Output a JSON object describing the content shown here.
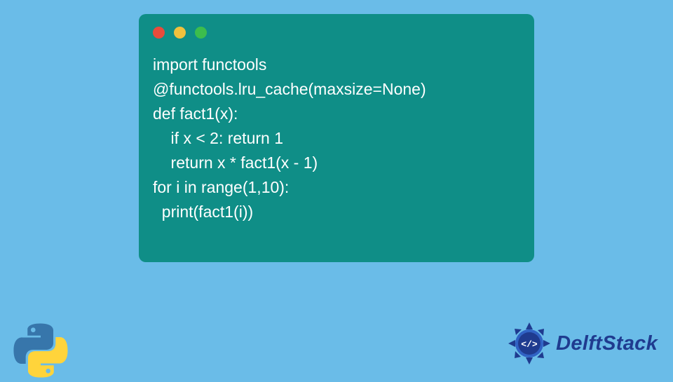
{
  "code": {
    "lines": [
      "import functools",
      "@functools.lru_cache(maxsize=None)",
      "def fact1(x):",
      "    if x < 2: return 1",
      "    return x * fact1(x - 1)",
      "for i in range(1,10):",
      "  print(fact1(i))"
    ]
  },
  "branding": {
    "name": "DelftStack"
  },
  "colors": {
    "background": "#6abce8",
    "codeWindow": "#0f8e87",
    "dotRed": "#e84b3c",
    "dotYellow": "#f0c13d",
    "dotGreen": "#3cbd4d",
    "brandText": "#1f3b8f"
  }
}
